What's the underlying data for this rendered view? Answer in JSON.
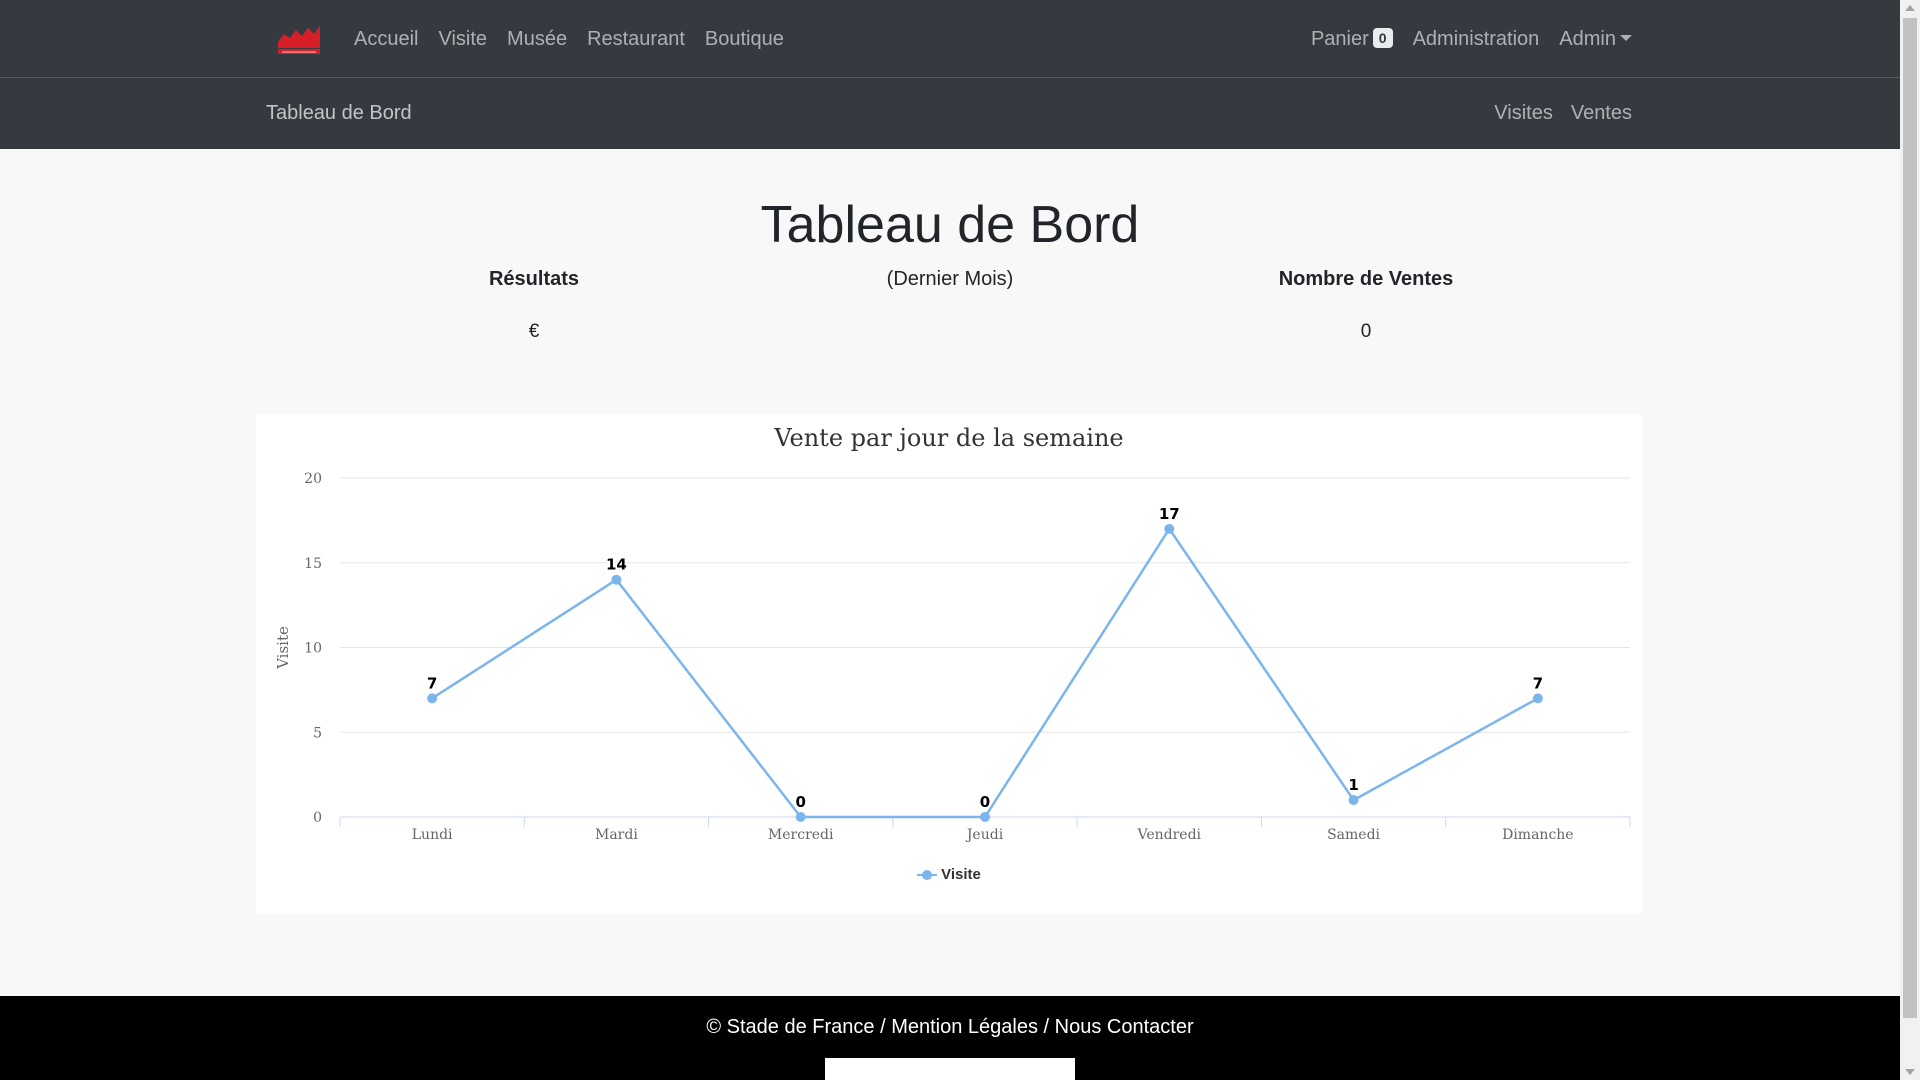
{
  "navbar": {
    "logo_icon": "stade-de-france-logo",
    "left_links": [
      "Accueil",
      "Visite",
      "Musée",
      "Restaurant",
      "Boutique"
    ],
    "cart_label": "Panier",
    "cart_count": "0",
    "admin_link": "Administration",
    "user_menu": "Admin"
  },
  "subnav": {
    "brand": "Tableau de Bord",
    "links": [
      "Visites",
      "Ventes"
    ]
  },
  "main": {
    "title": "Tableau de Bord",
    "results_label": "Résultats",
    "results_value": "€",
    "period_label": "(Dernier Mois)",
    "sales_label": "Nombre de Ventes",
    "sales_value": "0"
  },
  "chart_data": {
    "type": "line",
    "title": "Vente par jour de la semaine",
    "xlabel": "",
    "ylabel": "Visite",
    "categories": [
      "Lundi",
      "Mardi",
      "Mercredi",
      "Jeudi",
      "Vendredi",
      "Samedi",
      "Dimanche"
    ],
    "series": [
      {
        "name": "Visite",
        "values": [
          7,
          14,
          0,
          0,
          17,
          1,
          7
        ],
        "color": "#7cb5ec"
      }
    ],
    "ylim": [
      0,
      20
    ],
    "yticks": [
      0,
      5,
      10,
      15,
      20
    ],
    "grid": true,
    "data_labels": true,
    "legend": "bottom-center"
  },
  "footer": {
    "copyright": "© Stade de France",
    "sep": " / ",
    "legal": "Mention Légales",
    "contact": "Nous Contacter"
  },
  "colors": {
    "navbar_bg": "#343a40",
    "series": "#7cb5ec",
    "footer_bg": "#000000",
    "logo_red": "#d61f26"
  }
}
